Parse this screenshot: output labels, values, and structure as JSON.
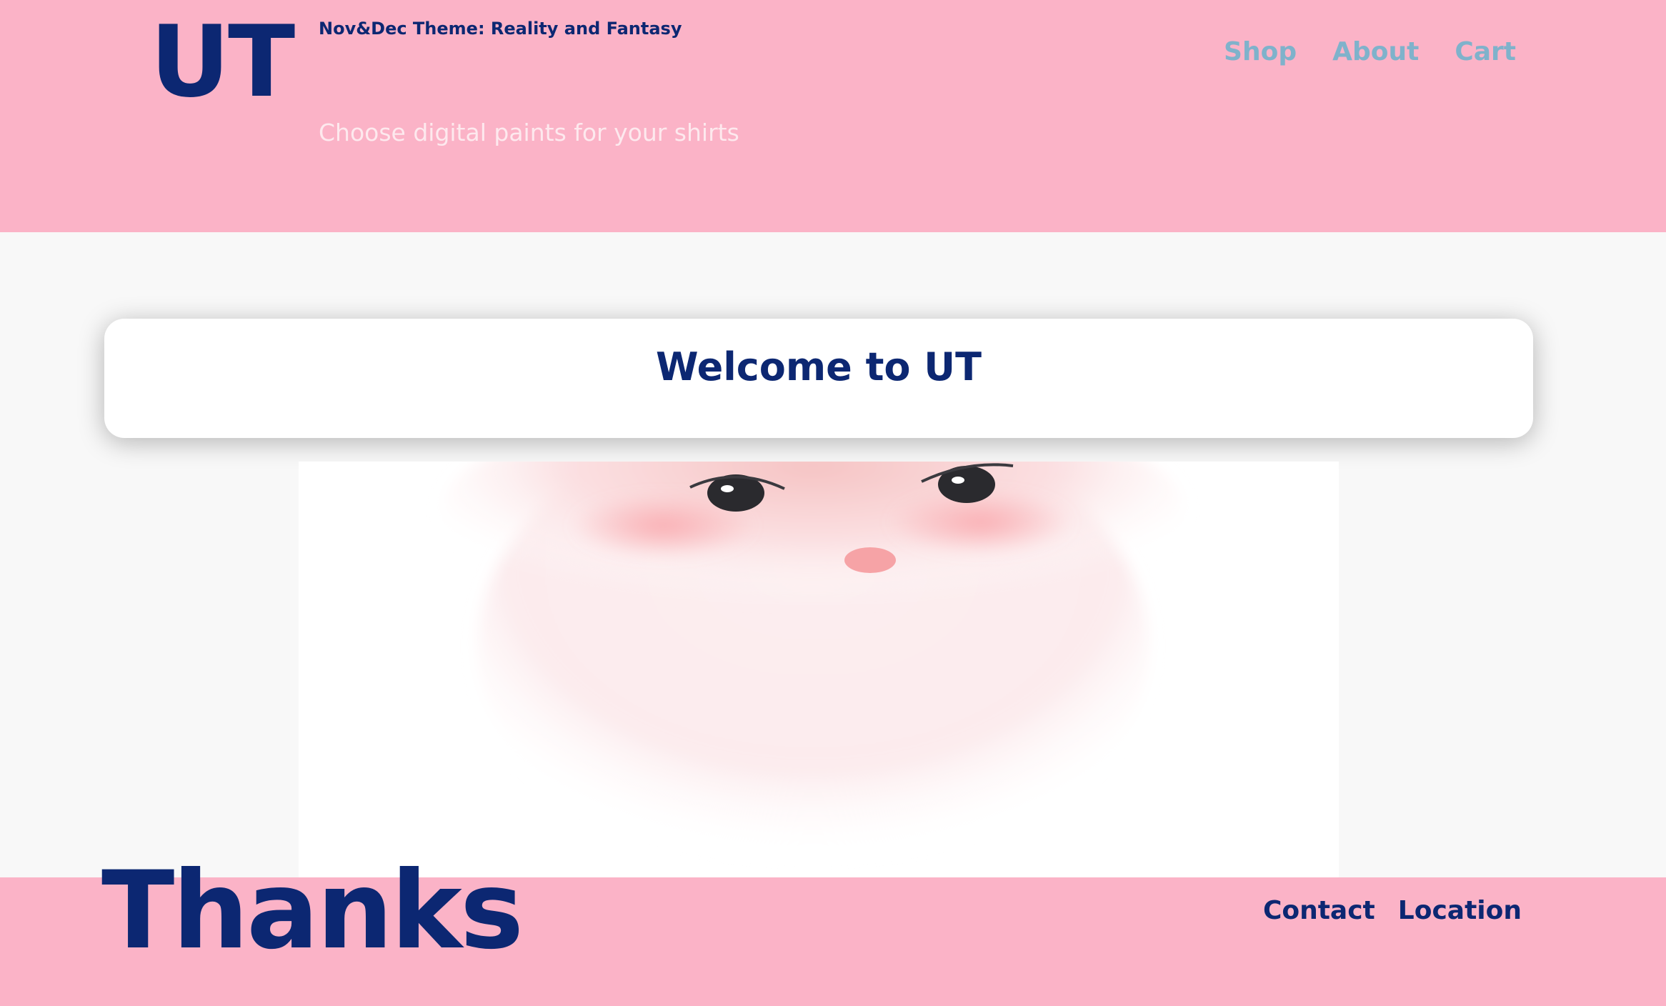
{
  "header": {
    "logo": "UT",
    "theme": "Nov&Dec Theme: Reality and Fantasy",
    "tagline": "Choose digital paints for your shirts",
    "nav": [
      "Shop",
      "About",
      "Cart"
    ]
  },
  "main": {
    "welcome_title": "Welcome to UT",
    "artwork": "santa-face-painting"
  },
  "footer": {
    "thanks": "Thanks",
    "links": [
      "Contact",
      "Location"
    ]
  },
  "colors": {
    "pink": "#fbb3c7",
    "navy": "#0c2772",
    "nav_blue": "#7fb2cb"
  }
}
